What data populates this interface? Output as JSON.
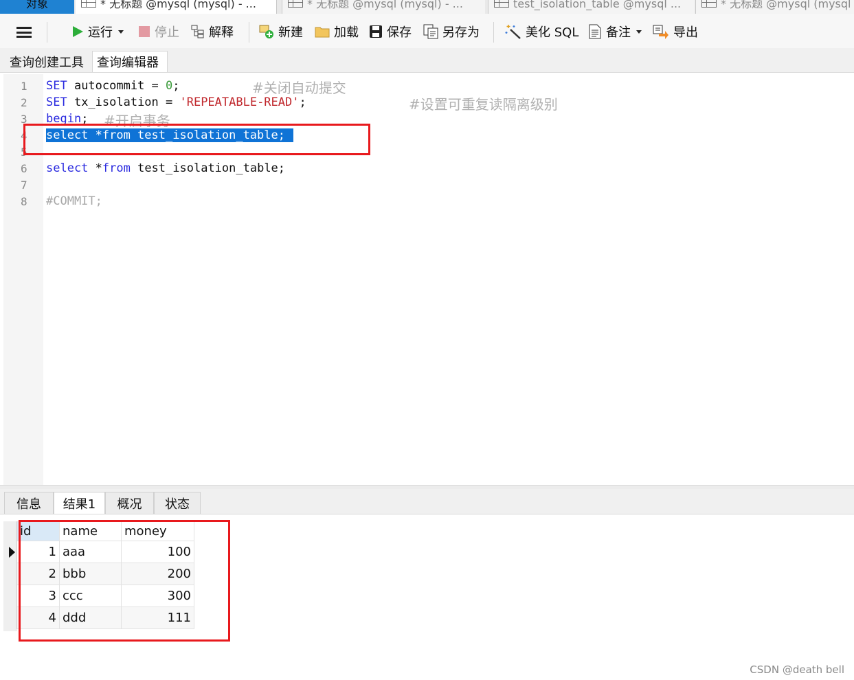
{
  "window_tabs": {
    "objects": "对象",
    "tab1": "* 无标题 @mysql (mysql) - ...",
    "tab2": "* 无标题 @mysql (mysql) - ...",
    "tab3": "test_isolation_table @mysql ...",
    "tab4": "* 无标题 @mysql (mysql"
  },
  "toolbar": {
    "run": "运行",
    "stop": "停止",
    "explain": "解释",
    "new": "新建",
    "load": "加载",
    "save": "保存",
    "save_as": "另存为",
    "beautify": "美化 SQL",
    "note": "备注",
    "export": "导出"
  },
  "sub_tabs": {
    "query_builder": "查询创建工具",
    "query_editor": "查询编辑器"
  },
  "editor": {
    "line_numbers": [
      "1",
      "2",
      "3",
      "4",
      "5",
      "6",
      "7",
      "8"
    ],
    "line1": {
      "kw": "SET",
      "mid": " autocommit = ",
      "num": "0",
      "end": ";",
      "comment": "#关闭自动提交"
    },
    "line2": {
      "kw": "SET",
      "mid": " tx_isolation = ",
      "str": "'REPEATABLE-READ'",
      "end": ";",
      "comment": "#设置可重复读隔离级别"
    },
    "line3": {
      "kw": "begin",
      "end": ";",
      "comment": "#开启事务"
    },
    "line4": "select *from test_isolation_table;",
    "line6": {
      "kw": "select",
      "mid": " *",
      "kw2": "from",
      "end": " test_isolation_table;"
    },
    "line8": "#COMMIT;"
  },
  "result_tabs": {
    "info": "信息",
    "result1": "结果1",
    "profile": "概况",
    "status": "状态"
  },
  "grid": {
    "columns": [
      "id",
      "name",
      "money"
    ],
    "rows": [
      {
        "id": "1",
        "name": "aaa",
        "money": "100"
      },
      {
        "id": "2",
        "name": "bbb",
        "money": "200"
      },
      {
        "id": "3",
        "name": "ccc",
        "money": "300"
      },
      {
        "id": "4",
        "name": "ddd",
        "money": "111"
      }
    ]
  },
  "watermark": "CSDN @death bell",
  "colors": {
    "accent": "#1f82d2",
    "selection": "#0f73d6",
    "highlight_box": "#e8191d",
    "keyword": "#2a2adf",
    "string": "#c0282d",
    "number": "#3a9a3a",
    "comment": "#a8a8a8"
  }
}
